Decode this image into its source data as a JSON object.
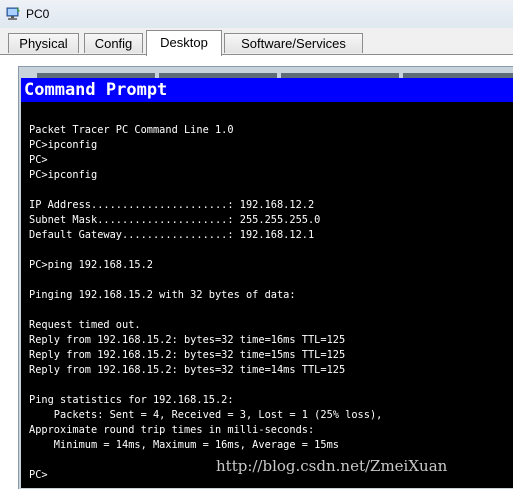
{
  "window": {
    "title": "PC0",
    "icon": "pc-computer-icon"
  },
  "tabs": [
    {
      "label": "Physical",
      "active": false
    },
    {
      "label": "Config",
      "active": false
    },
    {
      "label": "Desktop",
      "active": true
    },
    {
      "label": "Software/Services",
      "active": false
    }
  ],
  "command_prompt": {
    "title": "Command Prompt",
    "lines": [
      "Packet Tracer PC Command Line 1.0",
      "PC>ipconfig",
      "PC>",
      "PC>ipconfig",
      "",
      "IP Address......................: 192.168.12.2",
      "Subnet Mask.....................: 255.255.255.0",
      "Default Gateway.................: 192.168.12.1",
      "",
      "PC>ping 192.168.15.2",
      "",
      "Pinging 192.168.15.2 with 32 bytes of data:",
      "",
      "Request timed out.",
      "Reply from 192.168.15.2: bytes=32 time=16ms TTL=125",
      "Reply from 192.168.15.2: bytes=32 time=15ms TTL=125",
      "Reply from 192.168.15.2: bytes=32 time=14ms TTL=125",
      "",
      "Ping statistics for 192.168.15.2:",
      "    Packets: Sent = 4, Received = 3, Lost = 1 (25% loss),",
      "Approximate round trip times in milli-seconds:",
      "    Minimum = 14ms, Maximum = 16ms, Average = 15ms",
      "",
      "PC>"
    ]
  },
  "watermark": "http://blog.csdn.net/ZmeiXuan",
  "colors": {
    "title_bar": "#0000ff",
    "console_bg": "#000000",
    "console_text": "#ffffff"
  }
}
